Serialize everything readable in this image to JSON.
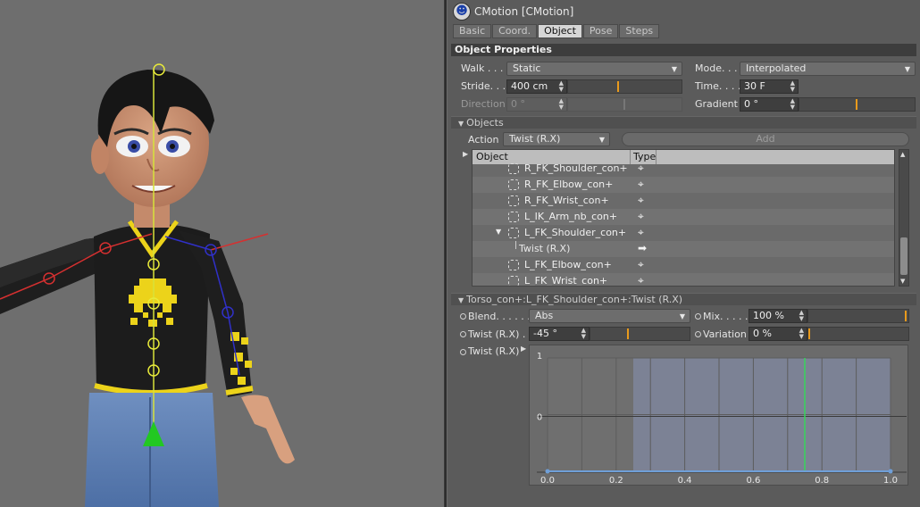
{
  "window": {
    "title": "CMotion [CMotion]"
  },
  "tabs": [
    {
      "label": "Basic",
      "active": false
    },
    {
      "label": "Coord.",
      "active": false
    },
    {
      "label": "Object",
      "active": true
    },
    {
      "label": "Pose",
      "active": false
    },
    {
      "label": "Steps",
      "active": false
    }
  ],
  "object_properties": {
    "header": "Object Properties",
    "walk": {
      "label": "Walk . . .",
      "value": "Static"
    },
    "mode": {
      "label": "Mode. . .",
      "value": "Interpolated"
    },
    "stride": {
      "label": "Stride. . .",
      "value": "400 cm",
      "slider_fraction": 0.45
    },
    "time": {
      "label": "Time. . . .",
      "value": "30 F"
    },
    "direction": {
      "label": "Direction",
      "value": "0 °",
      "slider_fraction": 0.5
    },
    "gradient": {
      "label": "Gradient",
      "value": "0 °",
      "slider_fraction": 0.5
    }
  },
  "objects_section": {
    "header": "Objects",
    "action": {
      "label": "Action",
      "value": "Twist (R.X)"
    },
    "add_button": "Add",
    "columns": {
      "object": "Object",
      "type": "Type"
    },
    "rows": [
      {
        "name": "R_FK_Shoulder_con+",
        "type_icon": "target-icon",
        "type": "⌖"
      },
      {
        "name": "R_FK_Elbow_con+",
        "type_icon": "target-icon",
        "type": "⌖"
      },
      {
        "name": "R_FK_Wrist_con+",
        "type_icon": "target-icon",
        "type": "⌖"
      },
      {
        "name": "L_IK_Arm_nb_con+",
        "type_icon": "target-icon",
        "type": "⌖"
      },
      {
        "name": "L_FK_Shoulder_con+",
        "type_icon": "target-icon",
        "type": "⌖",
        "expanded": true
      },
      {
        "name": "Twist (R.X)",
        "type_icon": "arrow-right-icon",
        "type": "➡",
        "child": true
      },
      {
        "name": "L_FK_Elbow_con+",
        "type_icon": "target-icon",
        "type": "⌖"
      },
      {
        "name": "L_FK_Wrist_con+",
        "type_icon": "target-icon",
        "type": "⌖"
      }
    ]
  },
  "twist_section": {
    "header": "Torso_con+:L_FK_Shoulder_con+:Twist (R.X)",
    "blend": {
      "label": "Blend. . . . . .",
      "value": "Abs"
    },
    "mix": {
      "label": "Mix. . . . . .",
      "value": "100 %",
      "slider_fraction": 1.0
    },
    "twist": {
      "label": "Twist (R.X) . .",
      "value": "-45 °",
      "slider_fraction": 0.38
    },
    "variation": {
      "label": "Variation",
      "value": "0 %",
      "slider_fraction": 0.0
    },
    "curve_label": "Twist (R.X)"
  },
  "graph": {
    "y_ticks": [
      "1",
      "0"
    ],
    "x_ticks": [
      "0.0",
      "0.2",
      "0.4",
      "0.6",
      "0.8",
      "1.0"
    ],
    "highlight_range": [
      0.25,
      1.0
    ],
    "marker_x": 0.75,
    "marker_color": "#37d45a",
    "curve_color": "#6f9fd8"
  },
  "colors": {
    "accent": "#e99a1c",
    "panel": "#5b5b5b",
    "header": "#3d3d3d"
  }
}
